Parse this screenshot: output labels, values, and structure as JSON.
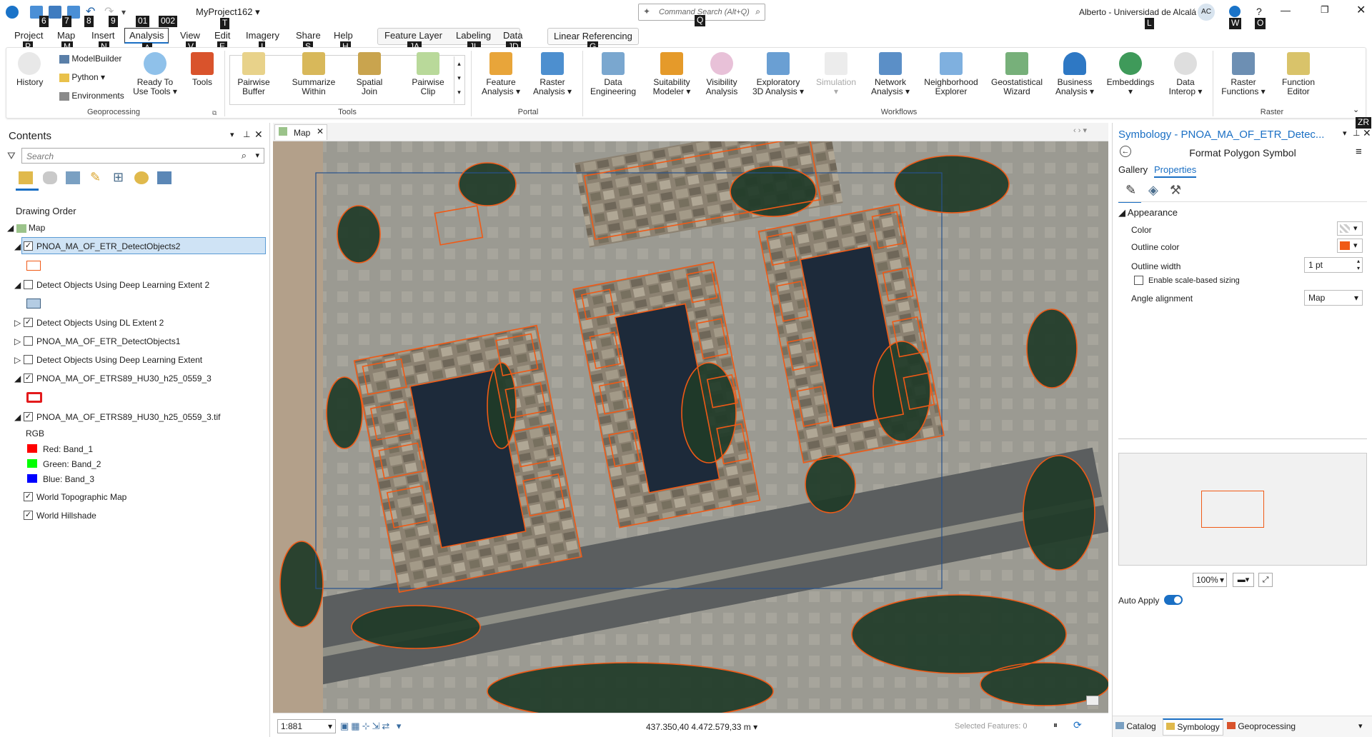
{
  "titlebar": {
    "project": "MyProject162",
    "search_placeholder": "Command Search (Alt+Q)",
    "user": "Alberto - Universidad de Alcalá",
    "avatar": "AC",
    "keytips": [
      "6",
      "7",
      "8",
      "9",
      "01",
      "002",
      "T",
      "Q",
      "L",
      "W",
      "O"
    ]
  },
  "menu": {
    "tabs": [
      "Project",
      "Map",
      "Insert",
      "Analysis",
      "View",
      "Edit",
      "Imagery",
      "Share",
      "Help"
    ],
    "active": "Analysis",
    "context_tabs": [
      "Feature Layer",
      "Labeling",
      "Data"
    ],
    "linear_ref": "Linear Referencing",
    "keytips": [
      "P",
      "M",
      "N",
      "A",
      "V",
      "E",
      "I",
      "S",
      "H",
      "JA",
      "JL",
      "JD",
      "G"
    ]
  },
  "ribbon": {
    "geoprocessing": {
      "label": "Geoprocessing",
      "history": "History",
      "modelbuilder": "ModelBuilder",
      "python": "Python",
      "environments": "Environments",
      "ready_tools": "Ready To Use Tools",
      "tools": "Tools"
    },
    "tools": {
      "label": "Tools",
      "items": [
        "Pairwise Buffer",
        "Summarize Within",
        "Spatial Join",
        "Pairwise Clip"
      ]
    },
    "portal": {
      "label": "Portal",
      "items": [
        "Feature Analysis",
        "Raster Analysis"
      ]
    },
    "workflows": {
      "label": "Workflows",
      "items": [
        "Data Engineering",
        "Suitability Modeler",
        "Visibility Analysis",
        "Exploratory 3D Analysis",
        "Simulation",
        "Network Analysis",
        "Neighborhood Explorer",
        "Geostatistical Wizard",
        "Business Analysis",
        "Embeddings",
        "Data Interop"
      ]
    },
    "raster": {
      "label": "Raster",
      "items": [
        "Raster Functions",
        "Function Editor"
      ]
    }
  },
  "contents": {
    "title": "Contents",
    "search_placeholder": "Search",
    "drawing_order": "Drawing Order",
    "map": "Map",
    "layers": [
      {
        "name": "PNOA_MA_OF_ETR_DetectObjects2",
        "checked": true,
        "selected": true
      },
      {
        "name": "Detect Objects Using Deep Learning Extent 2",
        "checked": false
      },
      {
        "name": "Detect Objects Using DL Extent 2",
        "checked": true
      },
      {
        "name": "PNOA_MA_OF_ETR_DetectObjects1",
        "checked": false
      },
      {
        "name": "Detect Objects Using Deep Learning Extent",
        "checked": false
      },
      {
        "name": "PNOA_MA_OF_ETRS89_HU30_h25_0559_3",
        "checked": true
      },
      {
        "name": "PNOA_MA_OF_ETRS89_HU30_h25_0559_3.tif",
        "checked": true
      },
      {
        "name": "World Topographic Map",
        "checked": true
      },
      {
        "name": "World Hillshade",
        "checked": true
      }
    ],
    "rgb": {
      "label": "RGB",
      "red": "Red:   Band_1",
      "green": "Green: Band_2",
      "blue": "Blue:  Band_3"
    }
  },
  "map": {
    "tab": "Map",
    "scale": "1:881",
    "coords": "437.350,40 4.472.579,33 m",
    "selected_features": "Selected Features: 0"
  },
  "symbology": {
    "title": "Symbology - PNOA_MA_OF_ETR_Detec...",
    "subtitle": "Format Polygon Symbol",
    "tab_gallery": "Gallery",
    "tab_properties": "Properties",
    "appearance": "Appearance",
    "color": "Color",
    "outline_color": "Outline color",
    "outline_width": "Outline width",
    "outline_width_value": "1 pt",
    "scale_sizing": "Enable scale-based sizing",
    "angle_alignment": "Angle alignment",
    "angle_value": "Map",
    "zoom": "100%",
    "auto_apply": "Auto Apply",
    "keytip": "ZR",
    "outline_hex": "#f05a16"
  },
  "bottom_tabs": [
    "Catalog",
    "Symbology",
    "Geoprocessing"
  ]
}
